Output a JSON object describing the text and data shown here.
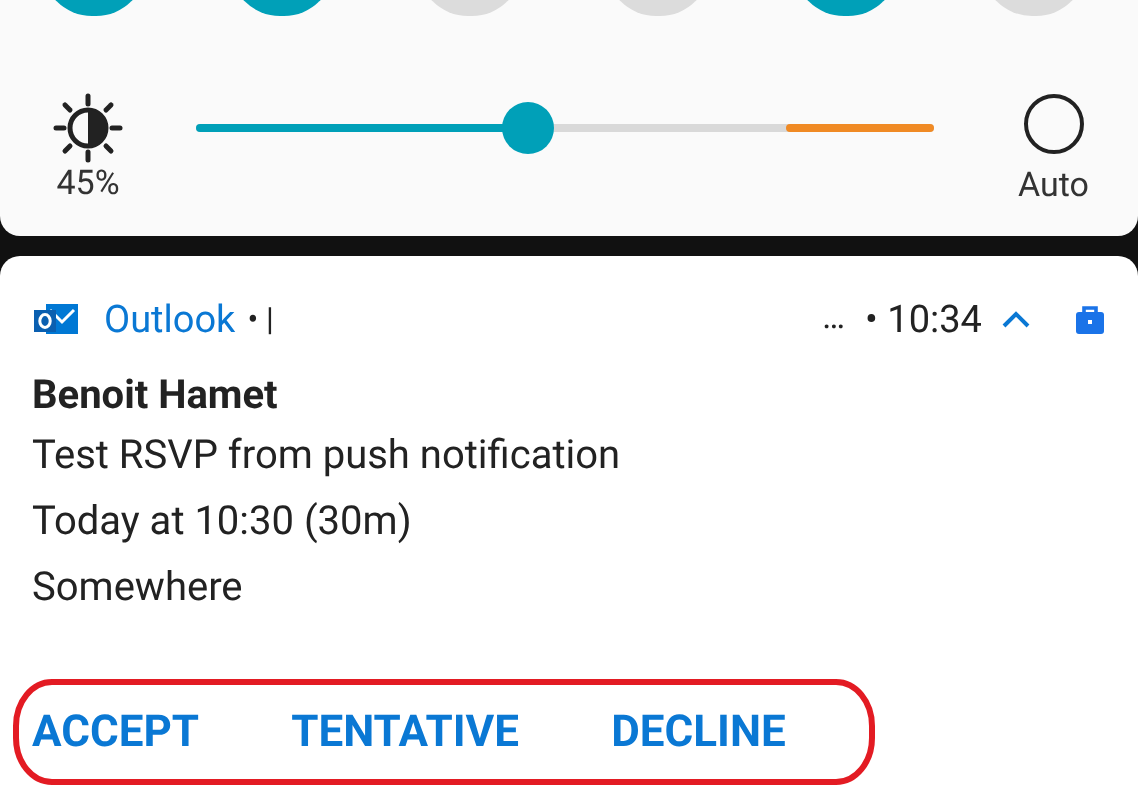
{
  "quick_tiles": [
    {
      "on": true
    },
    {
      "on": true
    },
    {
      "on": false
    },
    {
      "on": false
    },
    {
      "on": true
    },
    {
      "on": false
    }
  ],
  "brightness": {
    "level": 0.45,
    "reading": "45%"
  },
  "auto_brightness": {
    "label": "Auto",
    "checked": false
  },
  "notification": {
    "app": "Outlook",
    "app_suffix": "• |",
    "ellipsis": "…",
    "time": "• 10:34",
    "expanded": true,
    "title": "Benoit Hamet",
    "lines": [
      "Test RSVP from push notification",
      "Today at 10:30 (30m)",
      "Somewhere"
    ],
    "actions": [
      "ACCEPT",
      "TENTATIVE",
      "DECLINE"
    ]
  }
}
